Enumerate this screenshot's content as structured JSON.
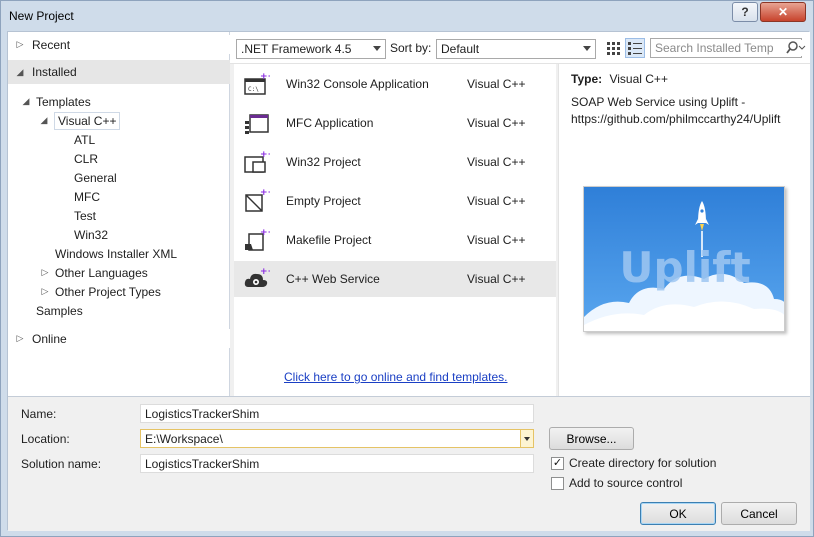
{
  "window": {
    "title": "New Project",
    "help": "?",
    "close": "✕"
  },
  "nav": {
    "recent": "Recent",
    "installed": "Installed",
    "templates": "Templates",
    "visual_cpp": "Visual C++",
    "atl": "ATL",
    "clr": "CLR",
    "general": "General",
    "mfc": "MFC",
    "test": "Test",
    "win32": "Win32",
    "windows_installer_xml": "Windows Installer XML",
    "other_languages": "Other Languages",
    "other_project_types": "Other Project Types",
    "samples": "Samples",
    "online": "Online"
  },
  "toolbar": {
    "framework": ".NET Framework 4.5",
    "sort_by_label": "Sort by:",
    "sort_value": "Default",
    "search_placeholder": "Search Installed Temp"
  },
  "templates": [
    {
      "name": "Win32 Console Application",
      "lang": "Visual C++",
      "icon": "console-app-icon"
    },
    {
      "name": "MFC Application",
      "lang": "Visual C++",
      "icon": "mfc-app-icon"
    },
    {
      "name": "Win32 Project",
      "lang": "Visual C++",
      "icon": "win32-project-icon"
    },
    {
      "name": "Empty Project",
      "lang": "Visual C++",
      "icon": "empty-project-icon"
    },
    {
      "name": "Makefile Project",
      "lang": "Visual C++",
      "icon": "makefile-project-icon"
    },
    {
      "name": "C++ Web Service",
      "lang": "Visual C++",
      "icon": "web-service-icon"
    }
  ],
  "online_link": "Click here to go online and find templates.",
  "details": {
    "type_label": "Type:",
    "type_value": "Visual C++",
    "description": "SOAP Web Service using Uplift - https://github.com/philmccarthy24/Uplift",
    "preview_logo_text": "Uplift"
  },
  "form": {
    "name_label": "Name:",
    "name_value": "LogisticsTrackerShim",
    "location_label": "Location:",
    "location_value": "E:\\Workspace\\",
    "solution_label": "Solution name:",
    "solution_value": "LogisticsTrackerShim",
    "browse": "Browse...",
    "create_dir": "Create directory for solution",
    "create_dir_checked": true,
    "add_source_control": "Add to source control",
    "add_source_control_checked": false,
    "ok": "OK",
    "cancel": "Cancel"
  },
  "colors": {
    "accent": "#3c7fb1",
    "link": "#1a3fc4",
    "preview_sky": "#2f7fd8"
  }
}
